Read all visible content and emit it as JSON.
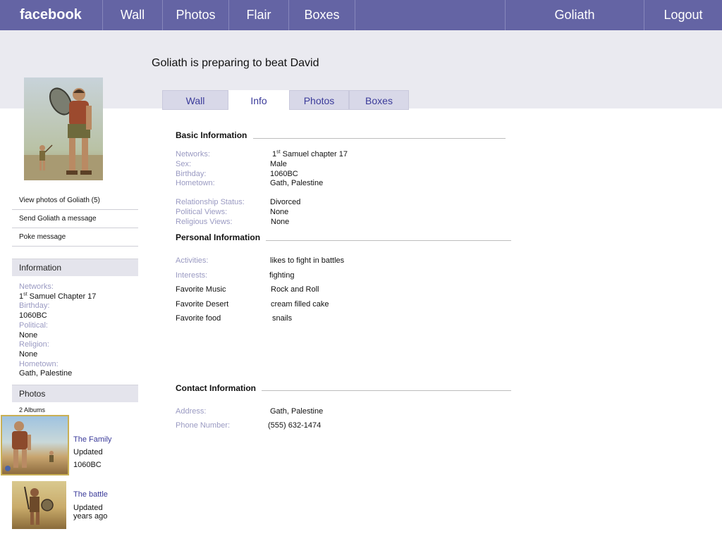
{
  "topbar": {
    "brand": "facebook",
    "nav": [
      "Wall",
      "Photos",
      "Flair",
      "Boxes"
    ],
    "user": "Goliath",
    "logout": "Logout"
  },
  "status": "Goliath is preparing to beat David",
  "tabs": [
    "Wall",
    "Info",
    "Photos",
    "Boxes"
  ],
  "active_tab": "Info",
  "sidebar": {
    "links": [
      "View photos of Goliath (5)",
      "Send Goliath a message",
      "Poke message"
    ],
    "information_header": "Information",
    "info": {
      "networks_label": "Networks:",
      "networks_prefix": "1",
      "networks_sup": "st",
      "networks_rest": " Samuel Chapter 17",
      "birthday_label": "Birthday:",
      "birthday": "1060BC",
      "political_label": "Political:",
      "political": "None",
      "religion_label": "Religion:",
      "religion": "None",
      "hometown_label": "Hometown:",
      "hometown": "Gath, Palestine"
    },
    "photos_header": "Photos",
    "albums_count": "2 Albums",
    "albums": [
      {
        "title": "The Family",
        "line1": "Updated",
        "line2": "1060BC"
      },
      {
        "title": "The battle",
        "line1": "Updated",
        "line2": "years ago"
      }
    ]
  },
  "basic": {
    "title": "Basic Information",
    "networks_label": "Networks:",
    "networks_prefix": "1",
    "networks_sup": "st",
    "networks_rest": " Samuel chapter 17",
    "sex_label": "Sex:",
    "sex": "Male",
    "birthday_label": "Birthday:",
    "birthday": "1060BC",
    "hometown_label": "Hometown:",
    "hometown": "Gath, Palestine",
    "relationship_label": "Relationship Status:",
    "relationship": "Divorced",
    "political_label": "Political Views:",
    "political": "None",
    "religious_label": "Religious Views:",
    "religious": "None"
  },
  "personal": {
    "title": "Personal Information",
    "activities_label": "Activities:",
    "activities": "likes to fight in battles",
    "interests_label": "Interests:",
    "interests": "fighting",
    "music_label": "Favorite Music",
    "music": "Rock and Roll",
    "desert_label": "Favorite Desert",
    "desert": "cream filled cake",
    "food_label": "Favorite food",
    "food": "snails"
  },
  "contact": {
    "title": "Contact Information",
    "address_label": "Address:",
    "address": "Gath, Palestine",
    "phone_label": "Phone Number:",
    "phone": "(555) 632-1474"
  }
}
